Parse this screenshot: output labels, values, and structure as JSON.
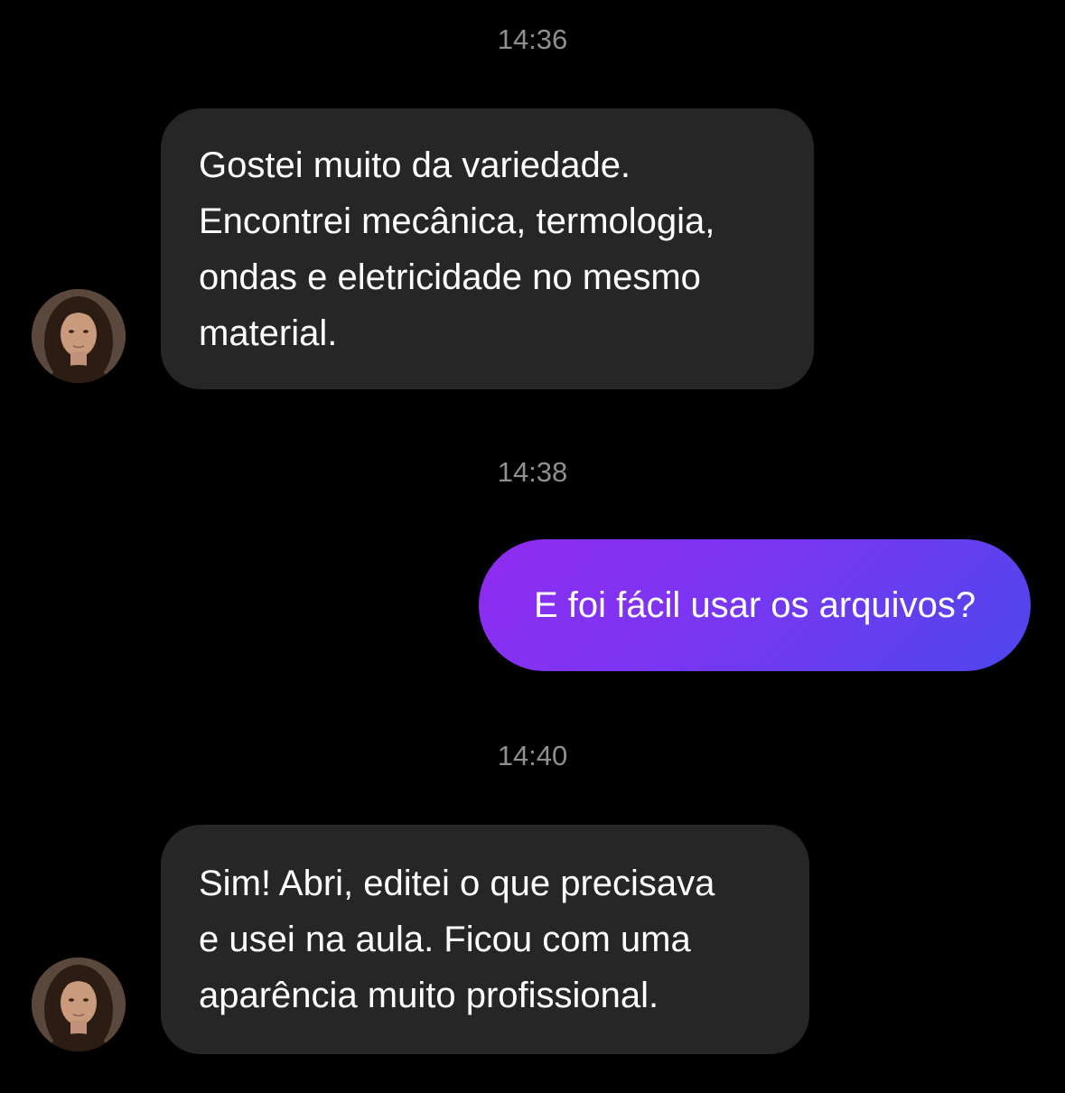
{
  "messages": [
    {
      "type": "timestamp",
      "text": "14:36"
    },
    {
      "type": "incoming",
      "lines": [
        "Gostei muito da variedade.",
        "Encontrei mecânica, termologia,",
        "ondas e eletricidade no mesmo",
        "material."
      ]
    },
    {
      "type": "timestamp",
      "text": "14:38"
    },
    {
      "type": "outgoing",
      "text": "E foi fácil usar os arquivos?"
    },
    {
      "type": "timestamp",
      "text": "14:40"
    },
    {
      "type": "incoming",
      "lines": [
        "Sim! Abri, editei o que precisava",
        "e usei na aula. Ficou com uma",
        "aparência muito profissional."
      ]
    }
  ],
  "colors": {
    "background": "#000000",
    "incoming_bubble": "#262626",
    "outgoing_gradient_start": "#8f2bf0",
    "outgoing_gradient_end": "#4d47ec",
    "timestamp_text": "#8e8e93"
  },
  "icons": {
    "avatar": "contact-avatar-photo"
  }
}
